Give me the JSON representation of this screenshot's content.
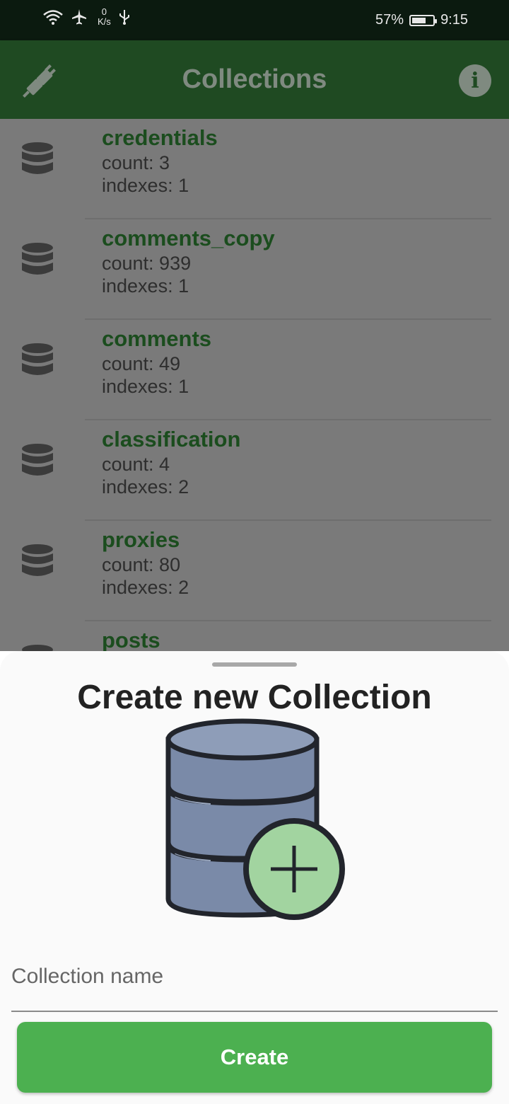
{
  "status_bar": {
    "net_speed_value": "0",
    "net_speed_unit": "K/s",
    "battery": "57%",
    "time": "9:15"
  },
  "app_bar": {
    "title": "Collections",
    "left_icon": "plug-icon",
    "right_icon": "info-icon"
  },
  "collections": [
    {
      "name": "credentials",
      "count": "count: 3",
      "indexes": "indexes: 1"
    },
    {
      "name": "comments_copy",
      "count": "count: 939",
      "indexes": "indexes: 1"
    },
    {
      "name": "comments",
      "count": "count: 49",
      "indexes": "indexes: 1"
    },
    {
      "name": "classification",
      "count": "count: 4",
      "indexes": "indexes: 2"
    },
    {
      "name": "proxies",
      "count": "count: 80",
      "indexes": "indexes: 2"
    },
    {
      "name": "posts",
      "count": "",
      "indexes": ""
    }
  ],
  "sheet": {
    "title": "Create new Collection",
    "input_placeholder": "Collection name",
    "input_value": "",
    "create_label": "Create"
  },
  "colors": {
    "app_bar": "#1f4a22",
    "accent_green": "#4cb050",
    "collection_name": "#1b4d1e"
  }
}
